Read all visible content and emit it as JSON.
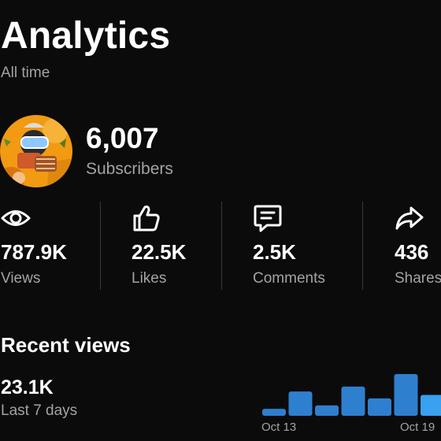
{
  "header": {
    "title": "Analytics",
    "range": "All time"
  },
  "channel": {
    "subscribers": "6,007",
    "subscribers_label": "Subscribers"
  },
  "stats": [
    {
      "icon": "eye-icon",
      "value": "787.9K",
      "label": "Views"
    },
    {
      "icon": "thumbs-up-icon",
      "value": "22.5K",
      "label": "Likes"
    },
    {
      "icon": "comment-icon",
      "value": "2.5K",
      "label": "Comments"
    },
    {
      "icon": "share-icon",
      "value": "436",
      "label": "Shares"
    }
  ],
  "recent": {
    "title": "Recent views",
    "value": "23.1K",
    "period": "Last 7 days"
  },
  "colors": {
    "background": "#0b0b0b",
    "bar": "#2f7fcf",
    "bar_highlight": "#3aa0f0",
    "secondary_text": "#a3a3a3"
  },
  "chart_data": {
    "type": "bar",
    "tick_labels": [
      "Oct 13",
      "Oct 19"
    ],
    "values": [
      1,
      3.5,
      1.5,
      4.2,
      2.5,
      6,
      3
    ]
  }
}
